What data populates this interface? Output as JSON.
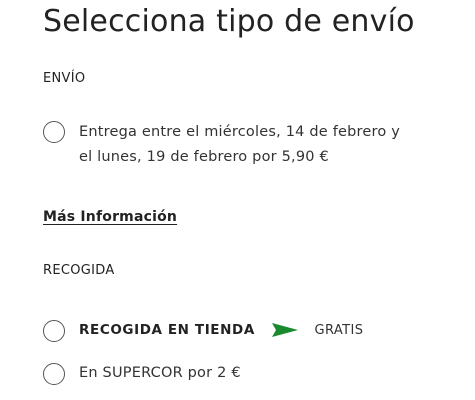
{
  "title": "Selecciona tipo de envío",
  "shipping": {
    "section_label": "ENVÍO",
    "option": {
      "line1": "Entrega entre el miércoles, 14 de febrero y",
      "line2": "el lunes, 19 de febrero por 5,90 €",
      "selected": false
    },
    "more_info_link": "Más Información"
  },
  "pickup": {
    "section_label": "RECOGIDA",
    "options": [
      {
        "name": "RECOGIDA EN TIENDA",
        "badge": "GRATIS",
        "icon": "green-flag-icon",
        "selected": false
      },
      {
        "name": "En SUPERCOR por 2 €",
        "selected": false
      }
    ]
  },
  "colors": {
    "flag": "#1a8a2e",
    "text": "#222222",
    "radio_border": "#555555"
  }
}
